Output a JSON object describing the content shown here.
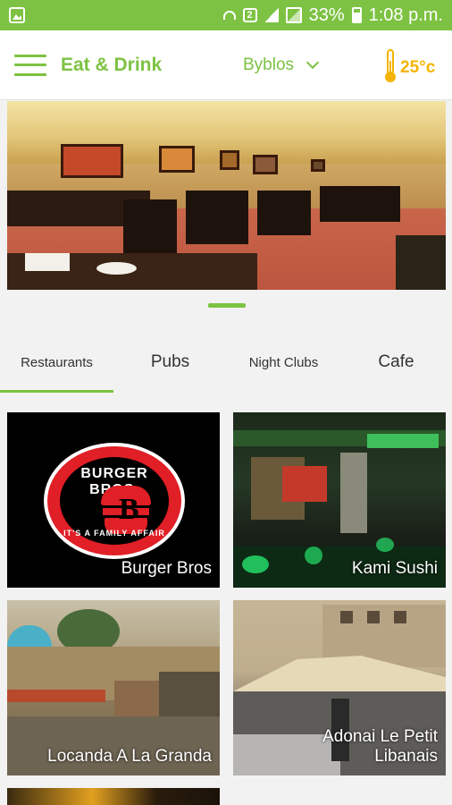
{
  "status_bar": {
    "battery": "33%",
    "time": "1:08 p.m.",
    "icons": [
      "image-notification-icon",
      "wifi-icon",
      "sim-2-icon",
      "signal-icon",
      "signal-icon",
      "battery-charging-icon"
    ]
  },
  "app_bar": {
    "title": "Eat & Drink",
    "city": "Byblos",
    "temperature": "25°c",
    "icons": [
      "menu-icon",
      "chevron-down-icon",
      "thermometer-icon"
    ]
  },
  "hero": {
    "carousel_position": 1
  },
  "tabs": [
    {
      "label": "Restaurants",
      "selected": true
    },
    {
      "label": "Pubs",
      "selected": false
    },
    {
      "label": "Night Clubs",
      "selected": false
    },
    {
      "label": "Cafe",
      "selected": false
    }
  ],
  "places": [
    {
      "name": "Burger Bros",
      "logo_text": "BURGER BROS.",
      "logo_tagline": "IT'S A FAMILY AFFAIR"
    },
    {
      "name": "Kami Sushi"
    },
    {
      "name": "Locanda A La Granda"
    },
    {
      "name": "Adonai Le Petit Libanais"
    }
  ],
  "colors": {
    "accent": "#7dc242",
    "temperature": "#f5b400",
    "logo_red": "#e01f26"
  }
}
